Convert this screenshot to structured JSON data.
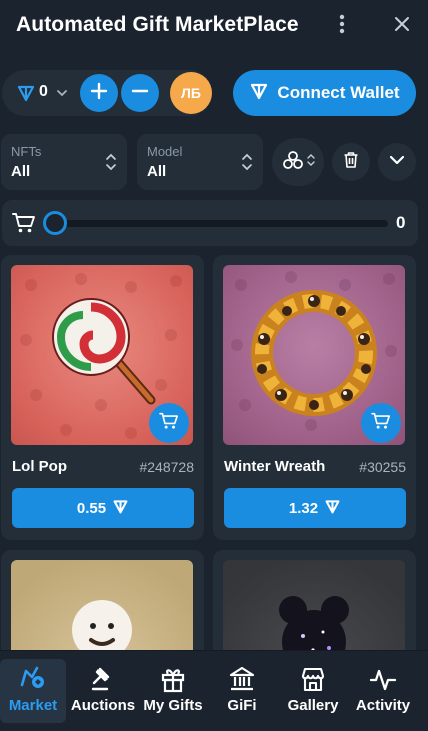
{
  "header": {
    "title": "Automated Gift MarketPlace"
  },
  "wallet": {
    "balance": "0",
    "avatar_initials": "ЛБ",
    "connect_label": "Connect Wallet"
  },
  "filters": {
    "nfts": {
      "label": "NFTs",
      "value": "All"
    },
    "model": {
      "label": "Model",
      "value": "All"
    }
  },
  "cart": {
    "count": "0"
  },
  "gifts": [
    {
      "name": "Lol Pop",
      "number": "#248728",
      "price": "0.55"
    },
    {
      "name": "Winter Wreath",
      "number": "#30255",
      "price": "1.32"
    }
  ],
  "nav": {
    "items": [
      {
        "label": "Market",
        "icon": "market-icon"
      },
      {
        "label": "Auctions",
        "icon": "gavel-icon"
      },
      {
        "label": "My Gifts",
        "icon": "gift-icon"
      },
      {
        "label": "GiFi",
        "icon": "bank-icon"
      },
      {
        "label": "Gallery",
        "icon": "store-icon"
      },
      {
        "label": "Activity",
        "icon": "activity-icon"
      }
    ],
    "active": "Market"
  },
  "colors": {
    "accent": "#1a8de0",
    "background": "#1b242e",
    "panel": "#232e39",
    "avatar": "#f6a94a"
  }
}
